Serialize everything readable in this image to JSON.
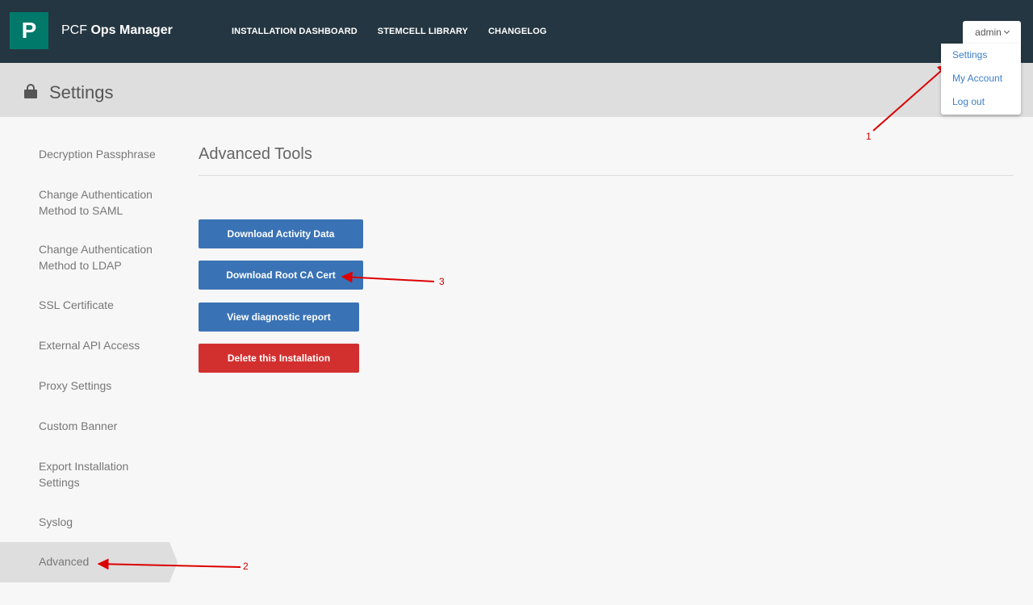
{
  "brand": {
    "logo_letter": "P",
    "name_prefix": "PCF",
    "name_bold": "Ops Manager",
    "logo_color": "#00796b"
  },
  "nav": {
    "items": [
      "INSTALLATION DASHBOARD",
      "STEMCELL LIBRARY",
      "CHANGELOG"
    ]
  },
  "user": {
    "name": "admin",
    "menu": [
      "Settings",
      "My Account",
      "Log out"
    ]
  },
  "header": {
    "title": "Settings",
    "icon": "lock-icon"
  },
  "sidebar": {
    "items": [
      "Decryption Passphrase",
      "Change Authentication Method to SAML",
      "Change Authentication Method to LDAP",
      "SSL Certificate",
      "External API Access",
      "Proxy Settings",
      "Custom Banner",
      "Export Installation Settings",
      "Syslog",
      "Advanced"
    ],
    "active": "Advanced"
  },
  "main": {
    "title": "Advanced Tools",
    "buttons": [
      {
        "label": "Download Activity Data",
        "color": "#3a73b5"
      },
      {
        "label": "Download Root CA Cert",
        "color": "#3a73b5"
      },
      {
        "label": "View diagnostic report",
        "color": "#3a73b5"
      },
      {
        "label": "Delete this Installation",
        "color": "#d2302f"
      }
    ]
  },
  "annotations": {
    "labels": [
      "1",
      "2",
      "3"
    ],
    "color": "#dd0000"
  }
}
